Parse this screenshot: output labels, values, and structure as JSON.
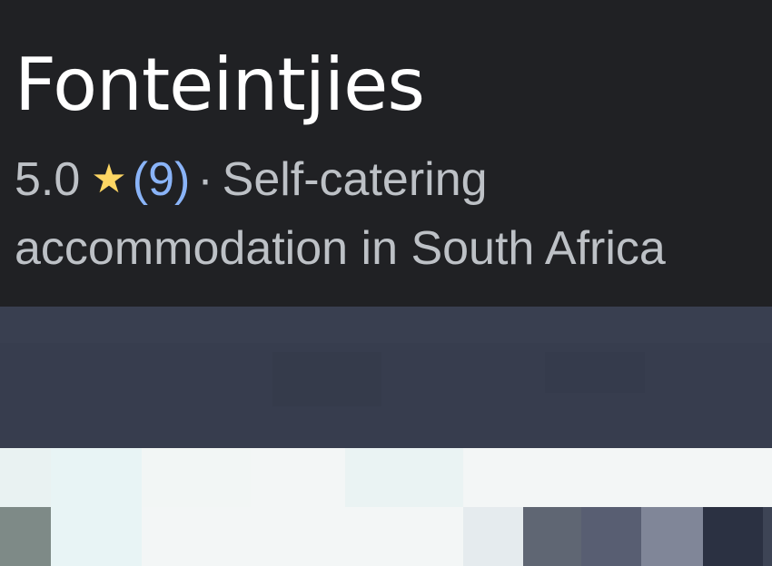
{
  "place": {
    "title": "Fonteintjies",
    "rating": "5.0",
    "star_icon": "star-icon",
    "review_count": "(9)",
    "separator": "·",
    "category_line1": "Self-catering",
    "category_line2": "accommodation in South Africa"
  },
  "colors": {
    "background": "#202124",
    "title": "#ffffff",
    "secondary_text": "#bdc1c6",
    "star": "#fdd663",
    "link": "#8ab4f8"
  }
}
